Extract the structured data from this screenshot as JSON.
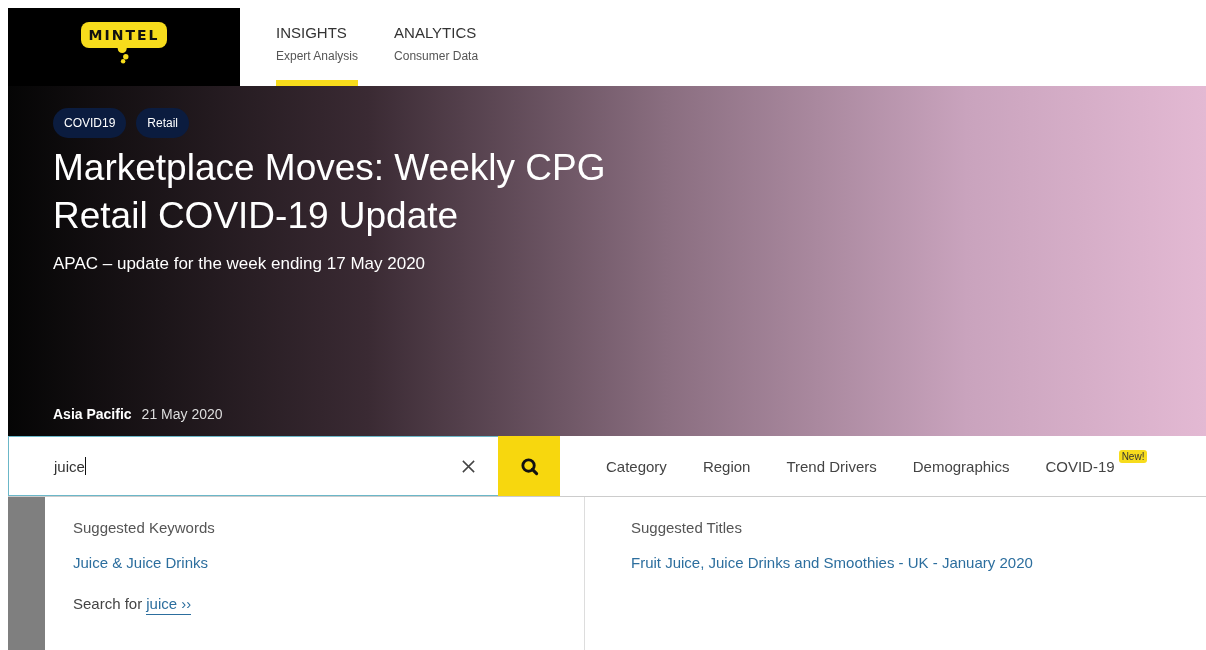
{
  "logo": {
    "text": "MINTEL"
  },
  "nav": [
    {
      "title": "INSIGHTS",
      "subtitle": "Expert Analysis",
      "selected": true
    },
    {
      "title": "ANALYTICS",
      "subtitle": "Consumer Data",
      "selected": false
    }
  ],
  "hero": {
    "tags": [
      "COVID19",
      "Retail"
    ],
    "title": "Marketplace Moves: Weekly CPG Retail COVID-19 Update",
    "subtitle": "APAC – update for the week ending 17 May 2020",
    "region": "Asia Pacific",
    "date": "21 May 2020"
  },
  "search": {
    "value": "juice"
  },
  "filters": [
    {
      "label": "Category"
    },
    {
      "label": "Region"
    },
    {
      "label": "Trend Drivers"
    },
    {
      "label": "Demographics"
    },
    {
      "label": "COVID-19",
      "badge": "New!"
    }
  ],
  "suggestions": {
    "keywords_heading": "Suggested Keywords",
    "keywords": [
      "Juice & Juice Drinks"
    ],
    "search_for": {
      "label": "Search for",
      "link": "juice ››"
    },
    "titles_heading": "Suggested Titles",
    "titles": [
      "Fruit Juice, Juice Drinks and Smoothies - UK - January 2020"
    ]
  }
}
